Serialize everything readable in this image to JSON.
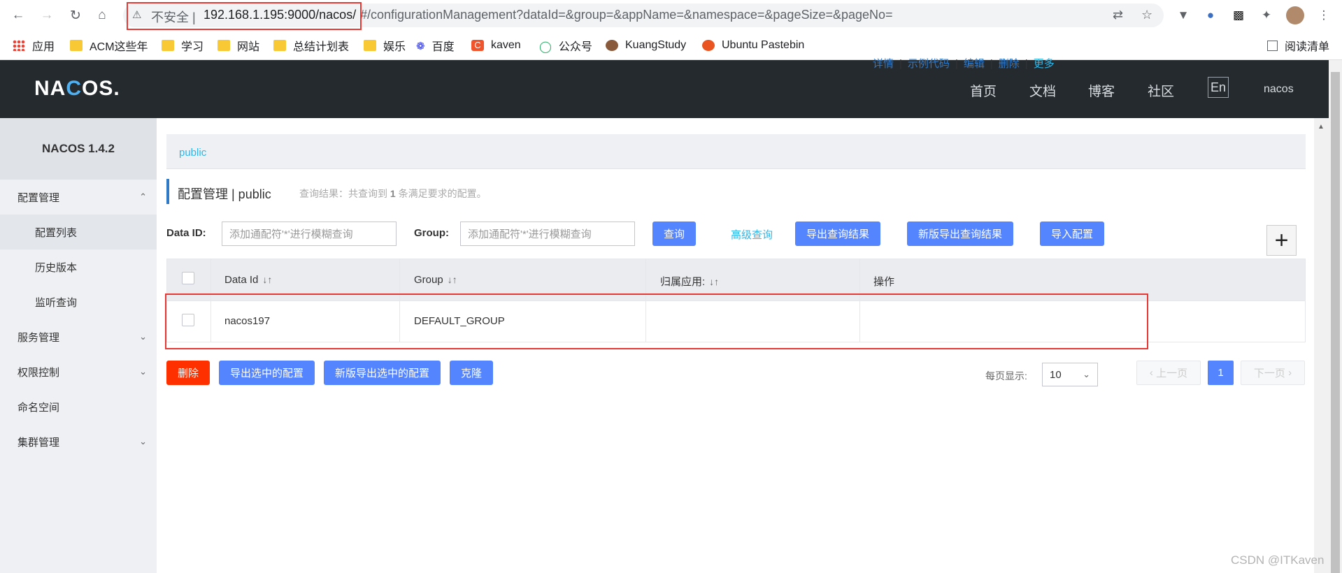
{
  "browser": {
    "insecure_label": "不安全 |",
    "url_host": "192.168.1.195:9000/nacos/",
    "url_path": "#/configurationManagement?dataId=&group=&appName=&namespace=&pageSize=&pageNo=",
    "bookmarks": [
      "应用",
      "ACM这些年",
      "学习",
      "网站",
      "总结计划表",
      "娱乐",
      "百度",
      "kaven",
      "公众号",
      "KuangStudy",
      "Ubuntu Pastebin"
    ],
    "reading_list": "阅读清单"
  },
  "header": {
    "logo_pre": "NA",
    "logo_c": "C",
    "logo_post": "OS.",
    "nav": [
      "首页",
      "文档",
      "博客",
      "社区"
    ],
    "lang": "En",
    "user": "nacos"
  },
  "sidebar": {
    "title": "NACOS 1.4.2",
    "items": [
      {
        "label": "配置管理"
      },
      {
        "label": "配置列表"
      },
      {
        "label": "历史版本"
      },
      {
        "label": "监听查询"
      },
      {
        "label": "服务管理"
      },
      {
        "label": "权限控制"
      },
      {
        "label": "命名空间"
      },
      {
        "label": "集群管理"
      }
    ]
  },
  "namespace": {
    "link": "public"
  },
  "page": {
    "title": "配置管理  |  public",
    "result_prefix": "查询结果：共查询到 ",
    "result_count": "1",
    "result_suffix": " 条满足要求的配置。"
  },
  "search": {
    "dataid_label": "Data ID:",
    "dataid_placeholder": "添加通配符'*'进行模糊查询",
    "group_label": "Group:",
    "group_placeholder": "添加通配符'*'进行模糊查询",
    "query": "查询",
    "advanced": "高级查询",
    "export": "导出查询结果",
    "export_new": "新版导出查询结果",
    "import": "导入配置"
  },
  "table": {
    "headers": [
      "Data Id",
      "Group",
      "归属应用:",
      "操作"
    ],
    "rows": [
      {
        "data_id": "nacos197",
        "group": "DEFAULT_GROUP",
        "app": ""
      }
    ],
    "ops": [
      "详情",
      "示例代码",
      "编辑",
      "删除",
      "更多"
    ]
  },
  "bulk": {
    "delete": "删除",
    "export_selected": "导出选中的配置",
    "export_selected_new": "新版导出选中的配置",
    "clone": "克隆"
  },
  "pagination": {
    "page_size_label": "每页显示:",
    "page_size": "10",
    "prev": "上一页",
    "current": "1",
    "next": "下一页"
  },
  "watermark": "CSDN @ITKaven"
}
